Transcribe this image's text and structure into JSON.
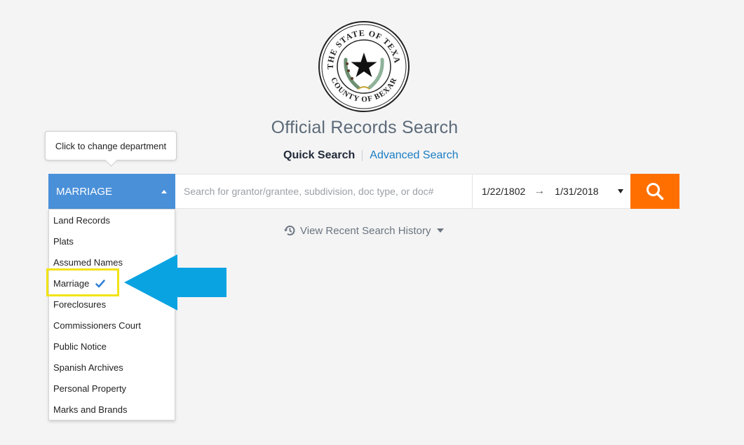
{
  "seal": {
    "top_text": "THE STATE OF TEXAS",
    "bottom_text": "COUNTY OF BEXAR"
  },
  "title": "Official Records Search",
  "tabs": {
    "quick": "Quick Search",
    "advanced": "Advanced Search"
  },
  "tooltip": "Click to change department",
  "department": {
    "selected": "MARRIAGE"
  },
  "search": {
    "placeholder": "Search for grantor/grantee, subdivision, doc type, or doc#"
  },
  "date_range": {
    "start": "1/22/1802",
    "arrow": "→",
    "end": "1/31/2018"
  },
  "dropdown_items": [
    "Land Records",
    "Plats",
    "Assumed Names",
    "Marriage",
    "Foreclosures",
    "Commissioners Court",
    "Public Notice",
    "Spanish Archives",
    "Personal Property",
    "Marks and Brands"
  ],
  "history": "View Recent Search History",
  "colors": {
    "accent_blue": "#4a90d9",
    "search_orange": "#ff6f00",
    "annotation_arrow": "#0aa3e2",
    "annotation_box": "#f2e315",
    "link_blue": "#1a7dc4"
  },
  "icons": {
    "search": "magnifier-icon",
    "history": "history-icon",
    "check": "checkmark-icon",
    "caret_up": "caret-up-icon",
    "caret_down": "caret-down-icon"
  }
}
